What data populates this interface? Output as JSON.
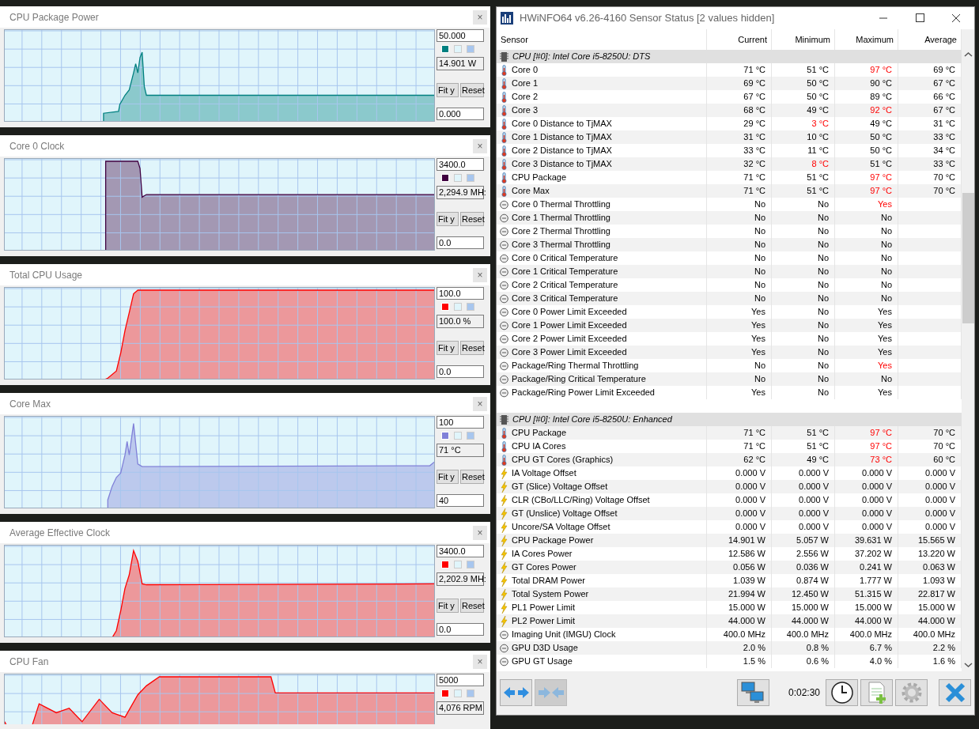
{
  "graphs": [
    {
      "title": "CPU Package Power",
      "close": "×",
      "max": "50.000",
      "current": "14.901 W",
      "min": "0.000",
      "color": "#008080",
      "buttons": [
        "Fit y",
        "Reset"
      ]
    },
    {
      "title": "Core 0 Clock",
      "close": "×",
      "max": "3400.0",
      "current": "2,294.9 MH:",
      "min": "0.0",
      "color": "#400040",
      "buttons": [
        "Fit y",
        "Reset"
      ]
    },
    {
      "title": "Total CPU Usage",
      "close": "×",
      "max": "100.0",
      "current": "100.0 %",
      "min": "0.0",
      "color": "#ff0000",
      "buttons": [
        "Fit y",
        "Reset"
      ]
    },
    {
      "title": "Core Max",
      "close": "×",
      "max": "100",
      "current": "71 °C",
      "min": "40",
      "color": "#8080d8",
      "buttons": [
        "Fit y",
        "Reset"
      ]
    },
    {
      "title": "Average Effective Clock",
      "close": "×",
      "max": "3400.0",
      "current": "2,202.9 MH:",
      "min": "0.0",
      "color": "#ff0000",
      "buttons": [
        "Fit y",
        "Reset"
      ]
    },
    {
      "title": "CPU Fan",
      "close": "×",
      "max": "5000",
      "current": "4,076 RPM",
      "color": "#ff0000"
    }
  ],
  "window": {
    "title": "HWiNFO64 v6.26-4160 Sensor Status [2 values hidden]"
  },
  "table": {
    "columns": [
      "Sensor",
      "Current",
      "Minimum",
      "Maximum",
      "Average"
    ],
    "sections": [
      {
        "title": "CPU [#0]: Intel Core i5-8250U: DTS",
        "rows": [
          {
            "kind": "temp",
            "name": "Core 0",
            "current": "71 °C",
            "minimum": "51 °C",
            "maximum": "97 °C",
            "average": "69 °C",
            "min_alert": false,
            "max_alert": true
          },
          {
            "kind": "temp",
            "name": "Core 1",
            "current": "69 °C",
            "minimum": "50 °C",
            "maximum": "90 °C",
            "average": "67 °C",
            "min_alert": false,
            "max_alert": false
          },
          {
            "kind": "temp",
            "name": "Core 2",
            "current": "67 °C",
            "minimum": "50 °C",
            "maximum": "89 °C",
            "average": "66 °C",
            "min_alert": false,
            "max_alert": false
          },
          {
            "kind": "temp",
            "name": "Core 3",
            "current": "68 °C",
            "minimum": "49 °C",
            "maximum": "92 °C",
            "average": "67 °C",
            "min_alert": false,
            "max_alert": true
          },
          {
            "kind": "temp",
            "name": "Core 0 Distance to TjMAX",
            "current": "29 °C",
            "minimum": "3 °C",
            "maximum": "49 °C",
            "average": "31 °C",
            "min_alert": true,
            "max_alert": false
          },
          {
            "kind": "temp",
            "name": "Core 1 Distance to TjMAX",
            "current": "31 °C",
            "minimum": "10 °C",
            "maximum": "50 °C",
            "average": "33 °C",
            "min_alert": false,
            "max_alert": false
          },
          {
            "kind": "temp",
            "name": "Core 2 Distance to TjMAX",
            "current": "33 °C",
            "minimum": "11 °C",
            "maximum": "50 °C",
            "average": "34 °C",
            "min_alert": false,
            "max_alert": false
          },
          {
            "kind": "temp",
            "name": "Core 3 Distance to TjMAX",
            "current": "32 °C",
            "minimum": "8 °C",
            "maximum": "51 °C",
            "average": "33 °C",
            "min_alert": true,
            "max_alert": false
          },
          {
            "kind": "temp",
            "name": "CPU Package",
            "current": "71 °C",
            "minimum": "51 °C",
            "maximum": "97 °C",
            "average": "70 °C",
            "min_alert": false,
            "max_alert": true
          },
          {
            "kind": "temp",
            "name": "Core Max",
            "current": "71 °C",
            "minimum": "51 °C",
            "maximum": "97 °C",
            "average": "70 °C",
            "min_alert": false,
            "max_alert": true
          },
          {
            "kind": "status",
            "name": "Core 0 Thermal Throttling",
            "current": "No",
            "minimum": "No",
            "maximum": "Yes",
            "min_alert": false,
            "max_alert": true
          },
          {
            "kind": "status",
            "name": "Core 1 Thermal Throttling",
            "current": "No",
            "minimum": "No",
            "maximum": "No",
            "min_alert": false,
            "max_alert": false
          },
          {
            "kind": "status",
            "name": "Core 2 Thermal Throttling",
            "current": "No",
            "minimum": "No",
            "maximum": "No",
            "min_alert": false,
            "max_alert": false
          },
          {
            "kind": "status",
            "name": "Core 3 Thermal Throttling",
            "current": "No",
            "minimum": "No",
            "maximum": "No",
            "min_alert": false,
            "max_alert": false
          },
          {
            "kind": "status",
            "name": "Core 0 Critical Temperature",
            "current": "No",
            "minimum": "No",
            "maximum": "No",
            "min_alert": false,
            "max_alert": false
          },
          {
            "kind": "status",
            "name": "Core 1 Critical Temperature",
            "current": "No",
            "minimum": "No",
            "maximum": "No",
            "min_alert": false,
            "max_alert": false
          },
          {
            "kind": "status",
            "name": "Core 2 Critical Temperature",
            "current": "No",
            "minimum": "No",
            "maximum": "No",
            "min_alert": false,
            "max_alert": false
          },
          {
            "kind": "status",
            "name": "Core 3 Critical Temperature",
            "current": "No",
            "minimum": "No",
            "maximum": "No",
            "min_alert": false,
            "max_alert": false
          },
          {
            "kind": "status",
            "name": "Core 0 Power Limit Exceeded",
            "current": "Yes",
            "minimum": "No",
            "maximum": "Yes",
            "min_alert": false,
            "max_alert": false
          },
          {
            "kind": "status",
            "name": "Core 1 Power Limit Exceeded",
            "current": "Yes",
            "minimum": "No",
            "maximum": "Yes",
            "min_alert": false,
            "max_alert": false
          },
          {
            "kind": "status",
            "name": "Core 2 Power Limit Exceeded",
            "current": "Yes",
            "minimum": "No",
            "maximum": "Yes",
            "min_alert": false,
            "max_alert": false
          },
          {
            "kind": "status",
            "name": "Core 3 Power Limit Exceeded",
            "current": "Yes",
            "minimum": "No",
            "maximum": "Yes",
            "min_alert": false,
            "max_alert": false
          },
          {
            "kind": "status",
            "name": "Package/Ring Thermal Throttling",
            "current": "No",
            "minimum": "No",
            "maximum": "Yes",
            "min_alert": false,
            "max_alert": true
          },
          {
            "kind": "status",
            "name": "Package/Ring Critical Temperature",
            "current": "No",
            "minimum": "No",
            "maximum": "No",
            "min_alert": false,
            "max_alert": false
          },
          {
            "kind": "status",
            "name": "Package/Ring Power Limit Exceeded",
            "current": "Yes",
            "minimum": "No",
            "maximum": "Yes",
            "min_alert": false,
            "max_alert": false
          }
        ]
      },
      {
        "title": "CPU [#0]: Intel Core i5-8250U: Enhanced",
        "rows": [
          {
            "kind": "temp",
            "name": "CPU Package",
            "current": "71 °C",
            "minimum": "51 °C",
            "maximum": "97 °C",
            "average": "70 °C",
            "min_alert": false,
            "max_alert": true
          },
          {
            "kind": "temp",
            "name": "CPU IA Cores",
            "current": "71 °C",
            "minimum": "51 °C",
            "maximum": "97 °C",
            "average": "70 °C",
            "min_alert": false,
            "max_alert": true
          },
          {
            "kind": "temp",
            "name": "CPU GT Cores (Graphics)",
            "current": "62 °C",
            "minimum": "49 °C",
            "maximum": "73 °C",
            "average": "60 °C",
            "min_alert": false,
            "max_alert": true
          },
          {
            "kind": "bolt",
            "name": "IA Voltage Offset",
            "current": "0.000 V",
            "minimum": "0.000 V",
            "maximum": "0.000 V",
            "average": "0.000 V",
            "min_alert": false,
            "max_alert": false
          },
          {
            "kind": "bolt",
            "name": "GT (Slice) Voltage Offset",
            "current": "0.000 V",
            "minimum": "0.000 V",
            "maximum": "0.000 V",
            "average": "0.000 V",
            "min_alert": false,
            "max_alert": false
          },
          {
            "kind": "bolt",
            "name": "CLR (CBo/LLC/Ring) Voltage Offset",
            "current": "0.000 V",
            "minimum": "0.000 V",
            "maximum": "0.000 V",
            "average": "0.000 V",
            "min_alert": false,
            "max_alert": false
          },
          {
            "kind": "bolt",
            "name": "GT (Unslice) Voltage Offset",
            "current": "0.000 V",
            "minimum": "0.000 V",
            "maximum": "0.000 V",
            "average": "0.000 V",
            "min_alert": false,
            "max_alert": false
          },
          {
            "kind": "bolt",
            "name": "Uncore/SA Voltage Offset",
            "current": "0.000 V",
            "minimum": "0.000 V",
            "maximum": "0.000 V",
            "average": "0.000 V",
            "min_alert": false,
            "max_alert": false
          },
          {
            "kind": "bolt",
            "name": "CPU Package Power",
            "current": "14.901 W",
            "minimum": "5.057 W",
            "maximum": "39.631 W",
            "average": "15.565 W",
            "min_alert": false,
            "max_alert": false
          },
          {
            "kind": "bolt",
            "name": "IA Cores Power",
            "current": "12.586 W",
            "minimum": "2.556 W",
            "maximum": "37.202 W",
            "average": "13.220 W",
            "min_alert": false,
            "max_alert": false
          },
          {
            "kind": "bolt",
            "name": "GT Cores Power",
            "current": "0.056 W",
            "minimum": "0.036 W",
            "maximum": "0.241 W",
            "average": "0.063 W",
            "min_alert": false,
            "max_alert": false
          },
          {
            "kind": "bolt",
            "name": "Total DRAM Power",
            "current": "1.039 W",
            "minimum": "0.874 W",
            "maximum": "1.777 W",
            "average": "1.093 W",
            "min_alert": false,
            "max_alert": false
          },
          {
            "kind": "bolt",
            "name": "Total System Power",
            "current": "21.994 W",
            "minimum": "12.450 W",
            "maximum": "51.315 W",
            "average": "22.817 W",
            "min_alert": false,
            "max_alert": false
          },
          {
            "kind": "bolt",
            "name": "PL1 Power Limit",
            "current": "15.000 W",
            "minimum": "15.000 W",
            "maximum": "15.000 W",
            "average": "15.000 W",
            "min_alert": false,
            "max_alert": false
          },
          {
            "kind": "bolt",
            "name": "PL2 Power Limit",
            "current": "44.000 W",
            "minimum": "44.000 W",
            "maximum": "44.000 W",
            "average": "44.000 W",
            "min_alert": false,
            "max_alert": false
          },
          {
            "kind": "status",
            "name": "Imaging Unit (IMGU) Clock",
            "current": "400.0 MHz",
            "minimum": "400.0 MHz",
            "maximum": "400.0 MHz",
            "average": "400.0 MHz",
            "min_alert": false,
            "max_alert": false
          },
          {
            "kind": "status",
            "name": "GPU D3D Usage",
            "current": "2.0 %",
            "minimum": "0.8 %",
            "maximum": "6.7 %",
            "average": "2.2 %",
            "min_alert": false,
            "max_alert": false
          },
          {
            "kind": "status",
            "name": "GPU GT Usage",
            "current": "1.5 %",
            "minimum": "0.6 %",
            "maximum": "4.0 %",
            "average": "1.6 %",
            "min_alert": false,
            "max_alert": false
          }
        ]
      }
    ]
  },
  "toolbar": {
    "timer": "0:02:30"
  }
}
